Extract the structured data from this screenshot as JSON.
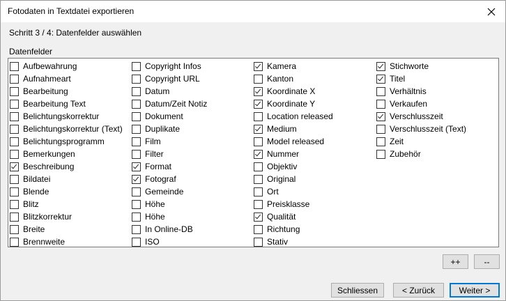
{
  "window": {
    "title": "Fotodaten in Textdatei exportieren",
    "close_glyph": "✕"
  },
  "step_label": "Schritt 3 / 4: Datenfelder auswählen",
  "group_label": "Datenfelder",
  "columns": [
    [
      {
        "label": "Aufbewahrung",
        "checked": false
      },
      {
        "label": "Aufnahmeart",
        "checked": false
      },
      {
        "label": "Bearbeitung",
        "checked": false
      },
      {
        "label": "Bearbeitung Text",
        "checked": false
      },
      {
        "label": "Belichtungskorrektur",
        "checked": false
      },
      {
        "label": "Belichtungskorrektur (Text)",
        "checked": false
      },
      {
        "label": "Belichtungsprogramm",
        "checked": false
      },
      {
        "label": "Bemerkungen",
        "checked": false
      },
      {
        "label": "Beschreibung",
        "checked": true
      },
      {
        "label": "Bildatei",
        "checked": false
      },
      {
        "label": "Blende",
        "checked": false
      },
      {
        "label": "Blitz",
        "checked": false
      },
      {
        "label": "Blitzkorrektur",
        "checked": false
      },
      {
        "label": "Breite",
        "checked": false
      },
      {
        "label": "Brennweite",
        "checked": false
      }
    ],
    [
      {
        "label": "Copyright Infos",
        "checked": false
      },
      {
        "label": "Copyright URL",
        "checked": false
      },
      {
        "label": "Datum",
        "checked": false
      },
      {
        "label": "Datum/Zeit Notiz",
        "checked": false
      },
      {
        "label": "Dokument",
        "checked": false
      },
      {
        "label": "Duplikate",
        "checked": false
      },
      {
        "label": "Film",
        "checked": false
      },
      {
        "label": "Filter",
        "checked": false
      },
      {
        "label": "Format",
        "checked": true
      },
      {
        "label": "Fotograf",
        "checked": true
      },
      {
        "label": "Gemeinde",
        "checked": false
      },
      {
        "label": "Höhe",
        "checked": false
      },
      {
        "label": "Höhe",
        "checked": false
      },
      {
        "label": "In Online-DB",
        "checked": false
      },
      {
        "label": "ISO",
        "checked": false
      }
    ],
    [
      {
        "label": "Kamera",
        "checked": true
      },
      {
        "label": "Kanton",
        "checked": false
      },
      {
        "label": "Koordinate X",
        "checked": true
      },
      {
        "label": "Koordinate Y",
        "checked": true
      },
      {
        "label": "Location released",
        "checked": false
      },
      {
        "label": "Medium",
        "checked": true
      },
      {
        "label": "Model released",
        "checked": false
      },
      {
        "label": "Nummer",
        "checked": true
      },
      {
        "label": "Objektiv",
        "checked": false
      },
      {
        "label": "Original",
        "checked": false
      },
      {
        "label": "Ort",
        "checked": false
      },
      {
        "label": "Preisklasse",
        "checked": false
      },
      {
        "label": "Qualität",
        "checked": true
      },
      {
        "label": "Richtung",
        "checked": false
      },
      {
        "label": "Stativ",
        "checked": false
      }
    ],
    [
      {
        "label": "Stichworte",
        "checked": true
      },
      {
        "label": "Titel",
        "checked": true
      },
      {
        "label": "Verhältnis",
        "checked": false
      },
      {
        "label": "Verkaufen",
        "checked": false
      },
      {
        "label": "Verschlusszeit",
        "checked": true
      },
      {
        "label": "Verschlusszeit (Text)",
        "checked": false
      },
      {
        "label": "Zeit",
        "checked": false
      },
      {
        "label": "Zubehör",
        "checked": false
      }
    ]
  ],
  "select_all_label": "++",
  "deselect_all_label": "--",
  "close_label": "Schliessen",
  "back_label": "< Zurück",
  "next_label": "Weiter >"
}
